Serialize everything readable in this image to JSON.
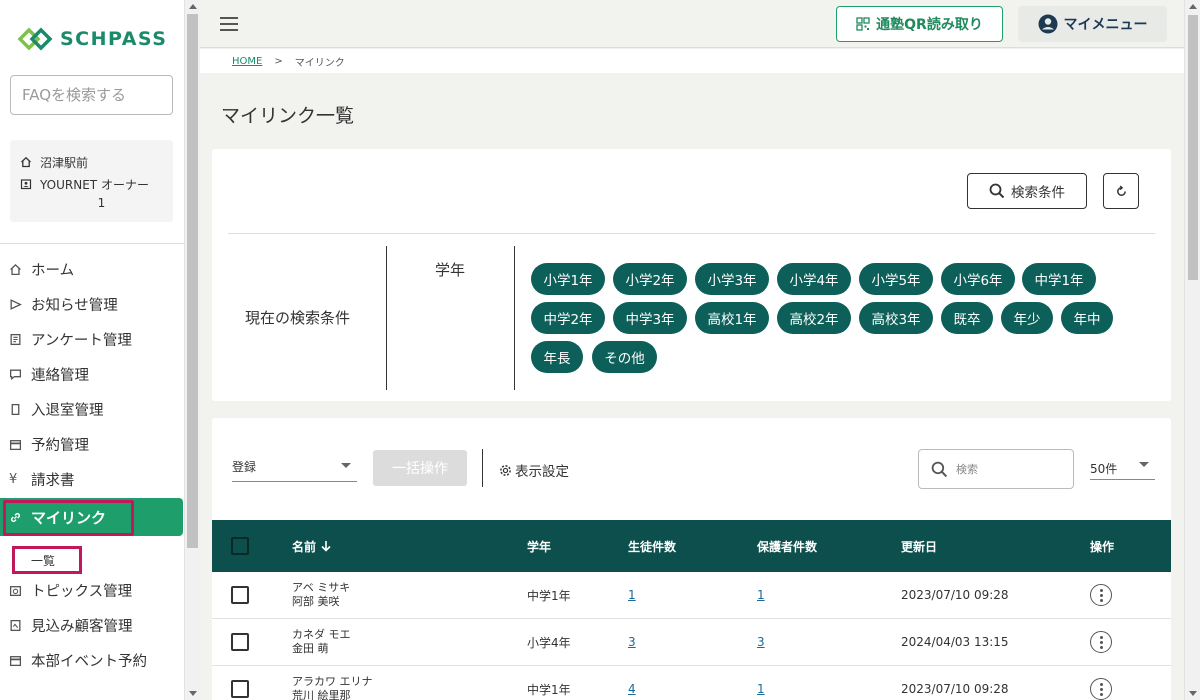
{
  "brand": {
    "name": "SCHPASS",
    "color": "#1a8a6b"
  },
  "sidebar": {
    "faq_placeholder": "FAQを検索する",
    "school": {
      "name": "沼津駅前",
      "user": "YOURNET オーナー",
      "user_no": "1"
    },
    "items": [
      {
        "label": "ホーム",
        "icon": "home-icon"
      },
      {
        "label": "お知らせ管理",
        "icon": "send-icon"
      },
      {
        "label": "アンケート管理",
        "icon": "survey-icon"
      },
      {
        "label": "連絡管理",
        "icon": "chat-icon"
      },
      {
        "label": "入退室管理",
        "icon": "door-icon"
      },
      {
        "label": "予約管理",
        "icon": "calendar-icon"
      },
      {
        "label": "請求書",
        "icon": "yen-icon"
      },
      {
        "label": "マイリンク",
        "icon": "link-icon",
        "active": true
      },
      {
        "label": "一覧",
        "sub": true
      },
      {
        "label": "トピックス管理",
        "icon": "topics-icon"
      },
      {
        "label": "見込み顧客管理",
        "icon": "prospect-icon"
      },
      {
        "label": "本部イベント予約",
        "icon": "event-icon"
      }
    ]
  },
  "header": {
    "qr_label": "通塾QR読み取り",
    "menu_label": "マイメニュー"
  },
  "breadcrumb": {
    "home": "HOME",
    "sep": ">",
    "current": "マイリンク"
  },
  "page_title": "マイリンク一覧",
  "search_card": {
    "search_btn": "検索条件",
    "current_label": "現在の検索条件",
    "field_label": "学年",
    "chips": [
      "小学1年",
      "小学2年",
      "小学3年",
      "小学4年",
      "小学5年",
      "小学6年",
      "中学1年",
      "中学2年",
      "中学3年",
      "高校1年",
      "高校2年",
      "高校3年",
      "既卒",
      "年少",
      "年中",
      "年長",
      "その他"
    ]
  },
  "list": {
    "action_select": "登録",
    "bulk_btn": "一括操作",
    "display_settings": "表示設定",
    "search_placeholder": "検索",
    "per_page": "50件",
    "columns": {
      "name": "名前",
      "grade": "学年",
      "students": "生徒件数",
      "guardians": "保護者件数",
      "updated": "更新日",
      "ops": "操作"
    },
    "rows": [
      {
        "kana": "アベ ミサキ",
        "name": "阿部 美咲",
        "grade": "中学1年",
        "students": "1",
        "guardians": "1",
        "updated": "2023/07/10 09:28"
      },
      {
        "kana": "カネダ モエ",
        "name": "金田 萌",
        "grade": "小学4年",
        "students": "3",
        "guardians": "3",
        "updated": "2024/04/03 13:15"
      },
      {
        "kana": "アラカワ エリナ",
        "name": "荒川 絵里那",
        "grade": "中学1年",
        "students": "4",
        "guardians": "1",
        "updated": "2023/07/10 09:28"
      }
    ]
  },
  "colors": {
    "accent": "#1e9e6a",
    "chip": "#0d5f5a",
    "table_header": "#0d4f4c",
    "highlight": "#c2185b"
  }
}
